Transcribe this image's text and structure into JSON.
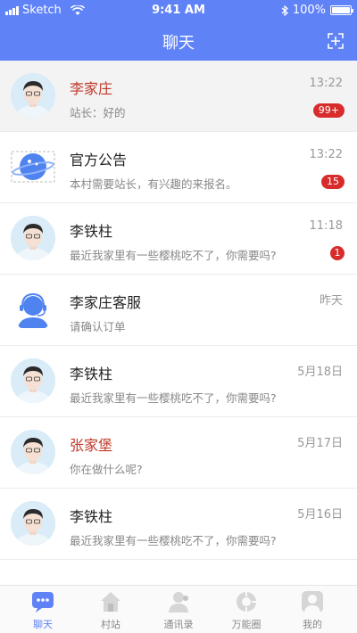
{
  "status_bar": {
    "carrier": "Sketch",
    "time": "9:41 AM",
    "battery": "100%"
  },
  "header": {
    "title": "聊天",
    "add_icon": "add-frame-icon"
  },
  "chats": [
    {
      "name": "李家庄",
      "message": "站长：好的",
      "time": "13:22",
      "badge": "99+",
      "name_color": "#c0392b",
      "highlight": true,
      "avatar": "person-avatar"
    },
    {
      "name": "官方公告",
      "message": "本村需要站长，有兴趣的来报名。",
      "time": "13:22",
      "badge": "15",
      "avatar": "planet-icon"
    },
    {
      "name": "李铁柱",
      "message": "最近我家里有一些樱桃吃不了，你需要吗?",
      "time": "11:18",
      "badge": "1",
      "avatar": "person-avatar"
    },
    {
      "name": "李家庄客服",
      "message": "请确认订单",
      "time": "昨天",
      "avatar": "customer-service-icon"
    },
    {
      "name": "李铁柱",
      "message": "最近我家里有一些樱桃吃不了，你需要吗?",
      "time": "5月18日",
      "avatar": "person-avatar"
    },
    {
      "name": "张家堡",
      "message": "你在做什么呢?",
      "time": "5月17日",
      "name_color": "#c0392b",
      "avatar": "person-avatar"
    },
    {
      "name": "李铁柱",
      "message": "最近我家里有一些樱桃吃不了，你需要吗?",
      "time": "5月16日",
      "avatar": "person-avatar"
    }
  ],
  "nav": [
    {
      "label": "聊天",
      "icon": "chat-bubble-icon",
      "active": true
    },
    {
      "label": "村站",
      "icon": "house-icon"
    },
    {
      "label": "通讯录",
      "icon": "contacts-icon"
    },
    {
      "label": "万能圈",
      "icon": "circle-icon"
    },
    {
      "label": "我的",
      "icon": "profile-icon"
    }
  ],
  "colors": {
    "primary": "#5f82f7",
    "badge": "#d82c2c",
    "name_red": "#c0392b"
  }
}
